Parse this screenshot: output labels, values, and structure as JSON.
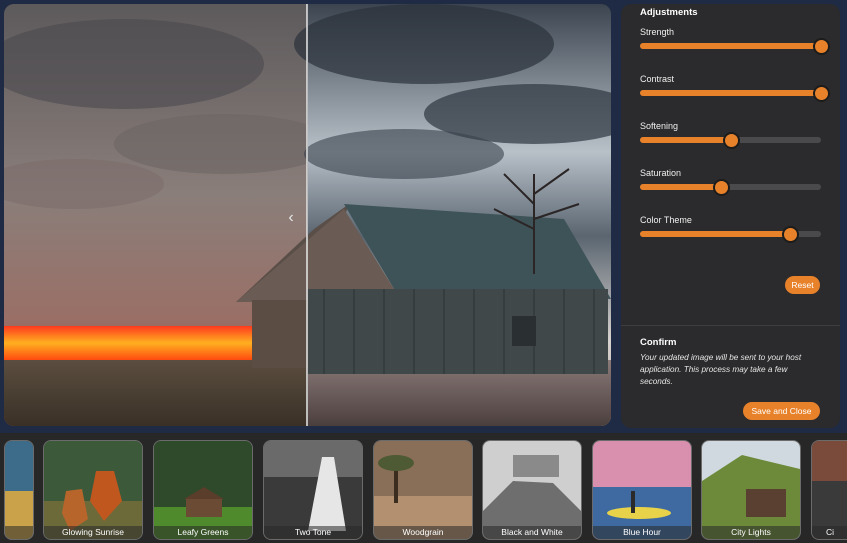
{
  "panel": {
    "title": "Adjustments",
    "sliders": [
      {
        "label": "Strength",
        "value": 100
      },
      {
        "label": "Contrast",
        "value": 100
      },
      {
        "label": "Softening",
        "value": 50
      },
      {
        "label": "Saturation",
        "value": 45
      },
      {
        "label": "Color Theme",
        "value": 83
      }
    ],
    "reset_label": "Reset",
    "confirm": {
      "title": "Confirm",
      "text": "Your updated image will be sent to your host application. This process may take a few seconds.",
      "button_label": "Save and Close"
    }
  },
  "preview": {
    "handle_glyph": "‹"
  },
  "filters": [
    {
      "label": ""
    },
    {
      "label": "Glowing Sunrise"
    },
    {
      "label": "Leafy Greens"
    },
    {
      "label": "Two Tone"
    },
    {
      "label": "Woodgrain"
    },
    {
      "label": "Black and White"
    },
    {
      "label": "Blue Hour"
    },
    {
      "label": "City Lights"
    },
    {
      "label": "Ci"
    }
  ],
  "colors": {
    "accent": "#e8822a",
    "panel": "#2b2b2d",
    "background": "#1f2a44"
  }
}
